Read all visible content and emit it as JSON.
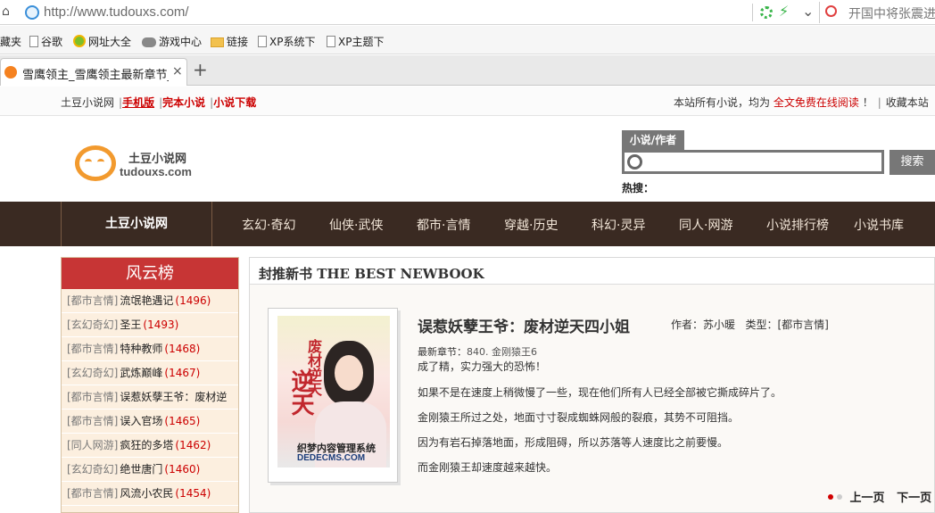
{
  "browser": {
    "url": "http://www.tudouxs.com/",
    "search_text": "开国中将张震进",
    "bookmarks": [
      "藏夹",
      "谷歌",
      "网址大全",
      "游戏中心",
      "链接",
      "XP系统下",
      "XP主题下"
    ],
    "tab_title": "雪鹰领主_雪鹰领主最新章节_雪",
    "tab_close": "×",
    "new_tab": "+"
  },
  "topbar": {
    "links": [
      "土豆小说网",
      "手机版",
      "完本小说",
      "小说下载"
    ],
    "separator": "|",
    "right_prefix": "本站所有小说，均为",
    "right_link": "全文免费在线阅读",
    "right_mark": "！",
    "right_suffix": "收藏本站"
  },
  "logo": {
    "name": "土豆小说网",
    "domain": "tudouxs.com"
  },
  "search": {
    "tab_label": "小说/作者",
    "button": "搜索",
    "hot_label": "热搜："
  },
  "nav": {
    "home": "土豆小说网",
    "items": [
      "玄幻·奇幻",
      "仙侠·武侠",
      "都市·言情",
      "穿越·历史",
      "科幻·灵异",
      "同人·网游",
      "小说排行榜",
      "小说书库"
    ]
  },
  "ranking": {
    "title": "风云榜",
    "items": [
      {
        "category": "[都市言情]",
        "name": "流氓艳遇记",
        "count": "(1496)"
      },
      {
        "category": "[玄幻奇幻]",
        "name": "圣王",
        "count": "(1493)"
      },
      {
        "category": "[都市言情]",
        "name": "特种教师",
        "count": "(1468)"
      },
      {
        "category": "[玄幻奇幻]",
        "name": "武炼巅峰",
        "count": "(1467)"
      },
      {
        "category": "[都市言情]",
        "name": "误惹妖孽王爷：废材逆",
        "count": ""
      },
      {
        "category": "[都市言情]",
        "name": "误入官场",
        "count": "(1465)"
      },
      {
        "category": "[同人网游]",
        "name": "疯狂的多塔",
        "count": "(1462)"
      },
      {
        "category": "[玄幻奇幻]",
        "name": "绝世唐门",
        "count": "(1460)"
      },
      {
        "category": "[都市言情]",
        "name": "风流小农民",
        "count": "(1454)"
      }
    ]
  },
  "featured": {
    "header": "封推新书 THE BEST NEWBOOK",
    "title": "误惹妖孽王爷：废材逆天四小姐",
    "author_label": "作者：",
    "author": "苏小暖",
    "type_label": "类型：",
    "type": "[都市言情]",
    "latest_label": "最新章节：",
    "latest": "840. 金刚猿王6",
    "paragraphs": [
      "成了精，实力强大的恐怖！",
      "如果不是在速度上稍微慢了一些，现在他们所有人已经全部被它撕成碎片了。",
      "金刚猿王所过之处，地面寸寸裂成蜘蛛网般的裂痕，其势不可阻挡。",
      "因为有岩石掉落地面，形成阻碍，所以苏落等人速度比之前要慢。",
      "而金刚猿王却速度越来越快。"
    ],
    "cover_title": "废材逆天",
    "cover_small": "逆天",
    "cover_wm1": "织梦内容管理系统",
    "cover_wm2": "DEDECMS.COM",
    "prev": "上一页",
    "next": "下一页"
  },
  "colors": {
    "accent_red": "#c00",
    "nav_bg": "#3a2a22",
    "rank_header": "#c73535"
  }
}
